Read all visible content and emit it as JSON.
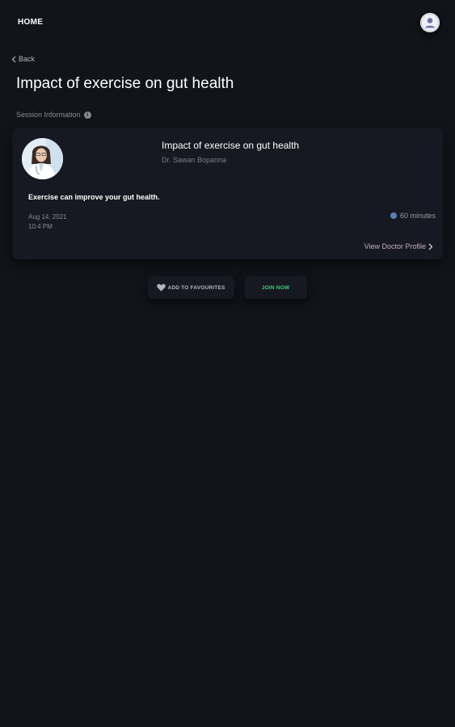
{
  "header": {
    "home_label": "HOME"
  },
  "nav": {
    "back_label": "Back"
  },
  "page": {
    "title": "Impact of exercise on gut health",
    "section_label": "Session Information"
  },
  "session": {
    "title": "Impact of exercise on gut health",
    "doctor": "Dr. Sawan Bopanna",
    "description": "Exercise can improve your gut health.",
    "date": "Aug 14, 2021",
    "time": "10:4 PM",
    "duration": "60 minutes",
    "profile_link": "View Doctor Profile"
  },
  "actions": {
    "favourites_label": "ADD TO FAVOURITES",
    "join_label": "JOIN NOW"
  },
  "colors": {
    "background": "#12141b",
    "card": "#171922",
    "join_accent": "#39d07a",
    "profile_link": "#c9a9c0"
  },
  "icons": {
    "avatar": "user-avatar-icon",
    "back": "chevron-left-icon",
    "info": "info-icon",
    "clock": "clock-icon",
    "profile_arrow": "chevron-right-icon",
    "heart": "heart-icon"
  }
}
